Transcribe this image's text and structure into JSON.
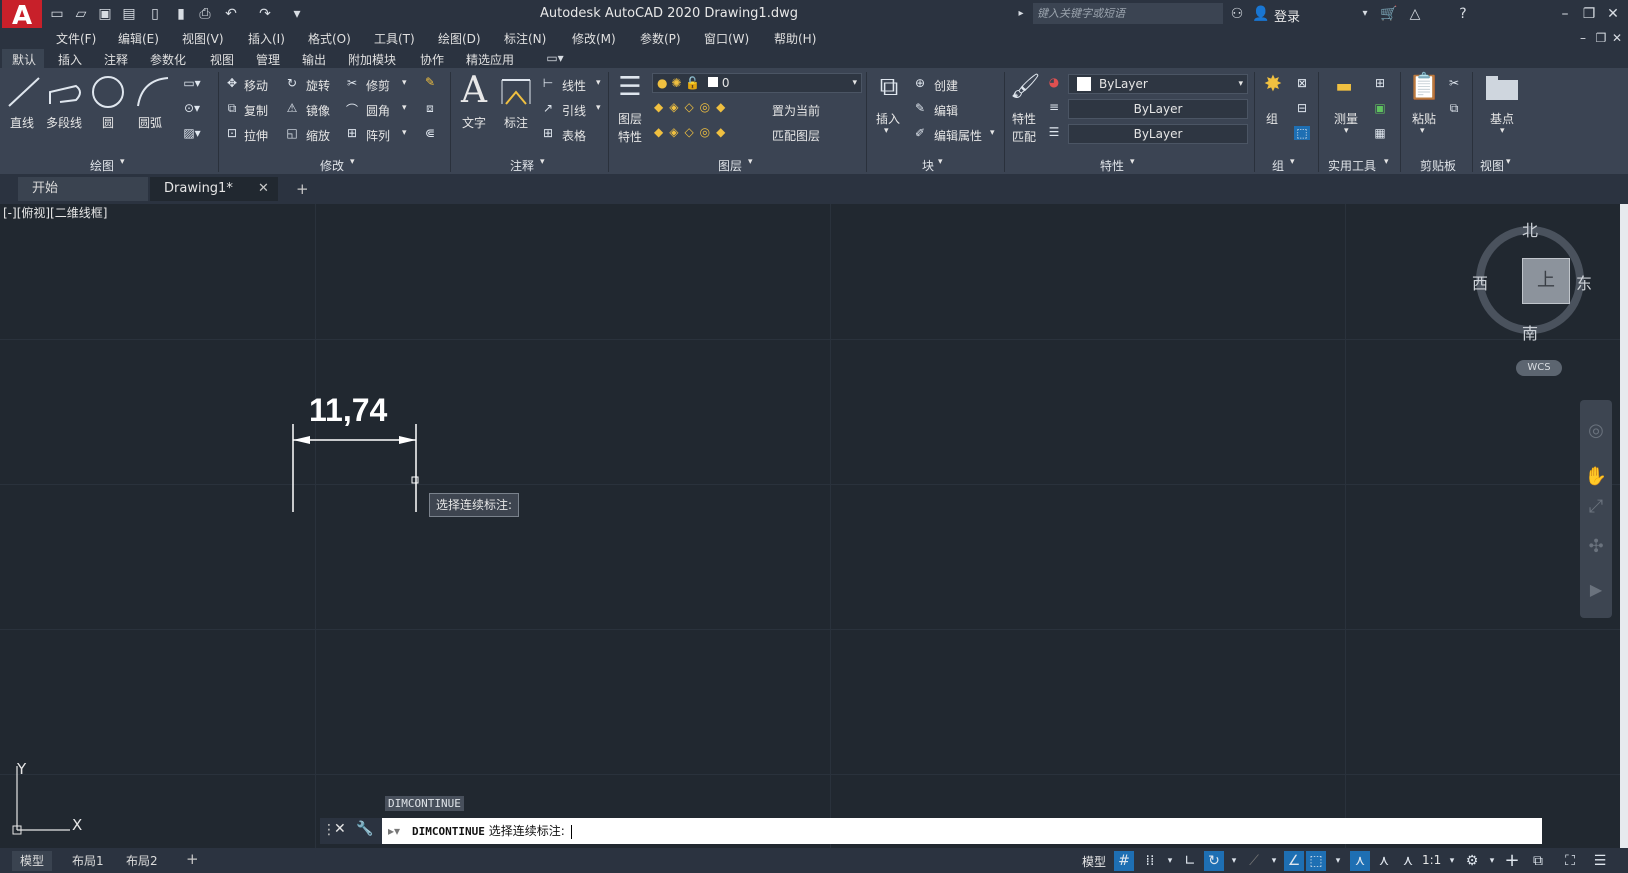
{
  "app": {
    "logo": "A",
    "title": "Autodesk AutoCAD 2020    Drawing1.dwg",
    "search_placeholder": "键入关键字或短语",
    "login": "登录"
  },
  "menu": [
    "文件(F)",
    "编辑(E)",
    "视图(V)",
    "插入(I)",
    "格式(O)",
    "工具(T)",
    "绘图(D)",
    "标注(N)",
    "修改(M)",
    "参数(P)",
    "窗口(W)",
    "帮助(H)"
  ],
  "ribbon_tabs": [
    "默认",
    "插入",
    "注释",
    "参数化",
    "视图",
    "管理",
    "输出",
    "附加模块",
    "协作",
    "精选应用"
  ],
  "panels": {
    "draw": {
      "title": "绘图",
      "line": "直线",
      "polyline": "多段线",
      "circle": "圆",
      "arc": "圆弧"
    },
    "modify": {
      "title": "修改",
      "move": "移动",
      "rotate": "旋转",
      "trim": "修剪",
      "copy": "复制",
      "mirror": "镜像",
      "fillet": "圆角",
      "stretch": "拉伸",
      "scale": "缩放",
      "array": "阵列"
    },
    "annotation": {
      "title": "注释",
      "text": "文字",
      "dimension": "标注",
      "linear": "线性",
      "leader": "引线",
      "table": "表格"
    },
    "layers": {
      "title": "图层",
      "layer_props_1": "图层",
      "layer_props_2": "特性",
      "current_layer": "0",
      "set_current": "置为当前",
      "match_layer": "匹配图层"
    },
    "block": {
      "title": "块",
      "insert": "插入",
      "create": "创建",
      "edit": "编辑",
      "edit_attr": "编辑属性"
    },
    "properties": {
      "title": "特性",
      "match_1": "特性",
      "match_2": "匹配",
      "color": "ByLayer",
      "linetype": "ByLayer",
      "lineweight": "ByLayer"
    },
    "groups": {
      "title": "组",
      "group": "组"
    },
    "utilities": {
      "title": "实用工具",
      "measure": "测量"
    },
    "clipboard": {
      "title": "剪贴板",
      "paste": "粘贴"
    },
    "view": {
      "title": "视图",
      "base": "基点"
    }
  },
  "file_tabs": {
    "start": "开始",
    "drawing": "Drawing1*",
    "close": "✕",
    "add": "+"
  },
  "viewport_label": "[-][俯视][二维线框]",
  "viewcube": {
    "north": "北",
    "south": "南",
    "east": "东",
    "west": "西",
    "top": "上",
    "wcs": "WCS"
  },
  "drawing": {
    "dimension_value": "11,74",
    "tooltip": "选择连续标注:"
  },
  "ucs": {
    "x": "X",
    "y": "Y"
  },
  "command": {
    "history": "DIMCONTINUE",
    "prompt_cmd": "DIMCONTINUE",
    "prompt_text": "选择连续标注:"
  },
  "layout_tabs": [
    "模型",
    "布局1",
    "布局2"
  ],
  "status": {
    "model": "模型",
    "scale": "1:1"
  },
  "colors": {
    "canvas": "#212830",
    "ribbon": "#3b4453",
    "logo": "#c8202a"
  }
}
